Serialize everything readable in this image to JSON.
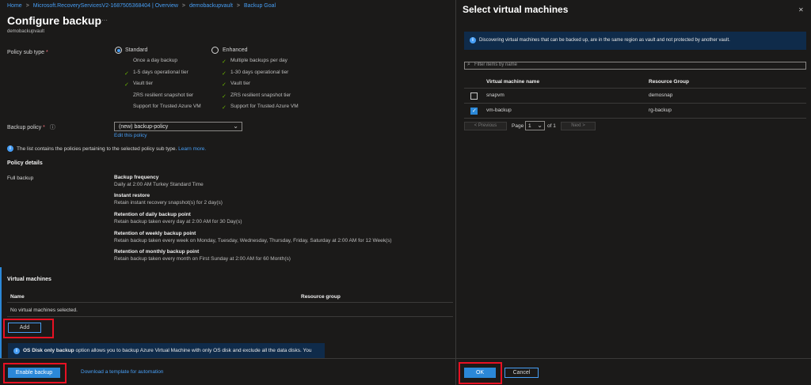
{
  "breadcrumb": {
    "items": [
      "Home",
      "Microsoft.RecoveryServicesV2-1687505368404 | Overview",
      "demobackupvault",
      "Backup Goal"
    ],
    "separator": ">"
  },
  "page": {
    "title": "Configure backup",
    "more": "···",
    "subtitle": "demobackupvault"
  },
  "policy_subtype": {
    "label": "Policy sub type",
    "required_mark": "*",
    "standard": {
      "label": "Standard",
      "selected": true,
      "features": [
        {
          "text": "Once a day backup",
          "check": false
        },
        {
          "text": "1-5 days operational tier",
          "check": true
        },
        {
          "text": "Vault tier",
          "check": true
        },
        {
          "text": "ZRS resilient snapshot tier",
          "check": false
        },
        {
          "text": "Support for Trusted Azure VM",
          "check": false
        }
      ]
    },
    "enhanced": {
      "label": "Enhanced",
      "selected": false,
      "features": [
        {
          "text": "Multiple backups per day",
          "check": true
        },
        {
          "text": "1-30 days operational tier",
          "check": true
        },
        {
          "text": "Vault tier",
          "check": true
        },
        {
          "text": "ZRS resilient snapshot tier",
          "check": true
        },
        {
          "text": "Support for Trusted Azure VM",
          "check": true
        }
      ]
    }
  },
  "backup_policy": {
    "label": "Backup policy",
    "required_mark": "*",
    "info_icon": "ⓘ",
    "value": "(new) backup-policy",
    "edit_link": "Edit this policy"
  },
  "policy_info": {
    "text": "The list contains the policies pertaining to the selected policy sub type.",
    "link": "Learn more."
  },
  "policy_details": {
    "heading": "Policy details",
    "row_label": "Full backup",
    "items": [
      {
        "title": "Backup frequency",
        "value": "Daily at 2:00 AM Turkey Standard Time"
      },
      {
        "title": "Instant restore",
        "value": "Retain instant recovery snapshot(s) for 2 day(s)"
      },
      {
        "title": "Retention of daily backup point",
        "value": "Retain backup taken every day at 2:00 AM for 30 Day(s)"
      },
      {
        "title": "Retention of weekly backup point",
        "value": "Retain backup taken every week on Monday, Tuesday, Wednesday, Thursday, Friday, Saturday at 2:00 AM for 12 Week(s)"
      },
      {
        "title": "Retention of monthly backup point",
        "value": "Retain backup taken every month on First Sunday at 2:00 AM for 60 Month(s)"
      }
    ]
  },
  "virtual_machines": {
    "heading": "Virtual machines",
    "col_name": "Name",
    "col_rg": "Resource group",
    "empty_text": "No virtual machines selected.",
    "add_label": "Add"
  },
  "disk_banner": {
    "bold": "OS Disk only backup",
    "text": "option allows you to backup Azure Virtual Machine with only OS disk and exclude all the data disks. You"
  },
  "footer_left": {
    "enable_label": "Enable backup",
    "template_link": "Download a template for automation"
  },
  "select_vm": {
    "title": "Select virtual machines",
    "close": "✕",
    "discover_text": "Discovering virtual machines that can be backed up, are in the same region as vault and not protected by another vault.",
    "filter_placeholder": "Filter items by name",
    "col_name": "Virtual machine name",
    "col_rg": "Resource Group",
    "rows": [
      {
        "name": "snapvm",
        "rg": "demosnap",
        "checked": false
      },
      {
        "name": "vm-backup",
        "rg": "rg-backup",
        "checked": true
      }
    ],
    "pager": {
      "prev": "< Previous",
      "page_label": "Page",
      "page_value": "1",
      "of_label": "of 1",
      "next": "Next >"
    },
    "ok_label": "OK",
    "cancel_label": "Cancel"
  },
  "colors": {
    "accent": "#2b88d8",
    "link": "#479ef5",
    "highlight": "#e81123",
    "check": "#6bb700"
  }
}
